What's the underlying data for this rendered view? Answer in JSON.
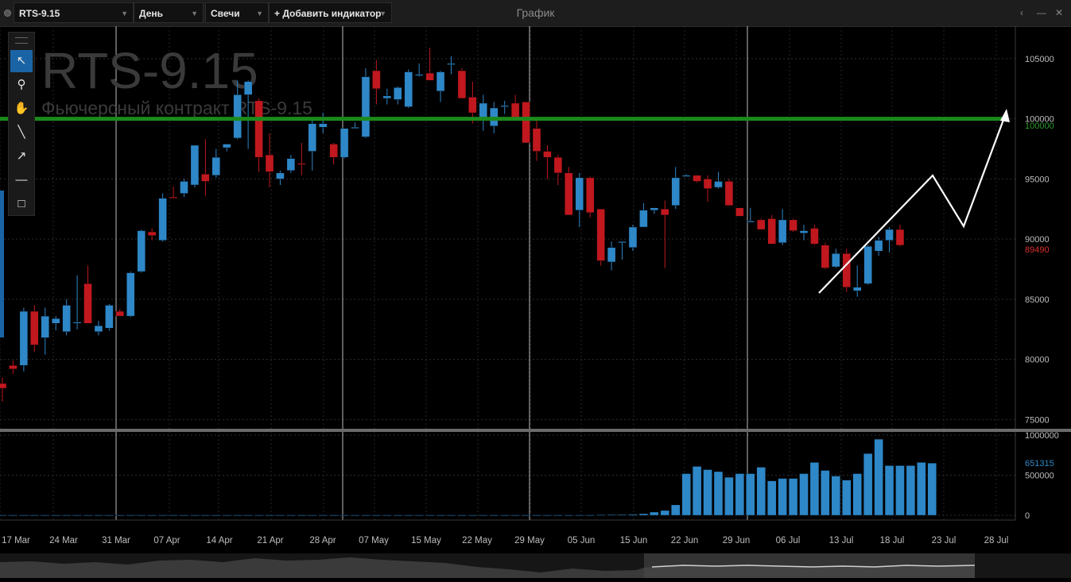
{
  "header": {
    "symbol": "RTS-9.15",
    "interval": "День",
    "chart_style": "Свечи",
    "add_indicator": "+ Добавить индикатор",
    "window_title": "График",
    "btn_back": "‹",
    "btn_min": "—",
    "btn_close": "✕"
  },
  "tools": [
    {
      "name": "pointer-icon",
      "glyph": "↖"
    },
    {
      "name": "zoom-icon",
      "glyph": "⚲"
    },
    {
      "name": "hand-icon",
      "glyph": "✋"
    },
    {
      "name": "line-icon",
      "glyph": "╲"
    },
    {
      "name": "arrow-icon",
      "glyph": "↗"
    },
    {
      "name": "horizontal-line-icon",
      "glyph": "—"
    },
    {
      "name": "rectangle-icon",
      "glyph": "□"
    }
  ],
  "colors": {
    "up": "#2e87c7",
    "down": "#c0181e",
    "level": "#1c8a1c",
    "volume": "#2e87c7",
    "price_label": "#d83030",
    "volume_label": "#2e87c7",
    "level_label": "#2a9a2a"
  },
  "chart_data": {
    "type": "candlestick",
    "watermark_title": "RTS-9.15",
    "watermark_subtitle": "Фьючерсный контракт RTS-9.15",
    "price_axis": {
      "ticks": [
        75000,
        80000,
        85000,
        90000,
        95000,
        100000,
        105000
      ],
      "range": [
        74300,
        107700
      ]
    },
    "volume_axis": {
      "ticks": [
        0,
        500000,
        1000000
      ],
      "labels": [
        "0",
        "500000",
        "1000000"
      ],
      "range": [
        0,
        1050000
      ]
    },
    "x_labels": [
      "17 Mar",
      "24 Mar",
      "31 Mar",
      "07 Apr",
      "14 Apr",
      "21 Apr",
      "28 Apr",
      "07 May",
      "15 May",
      "22 May",
      "29 May",
      "05 Jun",
      "15 Jun",
      "22 Jun",
      "29 Jun",
      "06 Jul",
      "13 Jul",
      "18 Jul",
      "23 Jul",
      "28 Jul"
    ],
    "last_price": "89490",
    "last_volume": "651315",
    "horizontal_level": {
      "value": 100000,
      "label": "100000"
    },
    "candles": [
      [
        78000,
        78500,
        76500,
        77600
      ],
      [
        79500,
        79900,
        78800,
        79200
      ],
      [
        79500,
        84300,
        79000,
        84000
      ],
      [
        84000,
        84500,
        80600,
        81200
      ],
      [
        81800,
        84300,
        80400,
        83600
      ],
      [
        83000,
        83600,
        82400,
        83400
      ],
      [
        82300,
        85000,
        82000,
        84500
      ],
      [
        83000,
        87000,
        82500,
        83100
      ],
      [
        86300,
        87800,
        83000,
        83000
      ],
      [
        82300,
        83200,
        82000,
        82800
      ],
      [
        82600,
        84600,
        82400,
        84500
      ],
      [
        84000,
        84200,
        83600,
        83600
      ],
      [
        83600,
        87300,
        83500,
        87200
      ],
      [
        87300,
        90800,
        87200,
        90700
      ],
      [
        90600,
        90900,
        89900,
        90300
      ],
      [
        89900,
        93800,
        89800,
        93400
      ],
      [
        93500,
        94400,
        93400,
        93400
      ],
      [
        93800,
        95000,
        93500,
        94800
      ],
      [
        94500,
        96900,
        94300,
        97800
      ],
      [
        95400,
        98300,
        93600,
        94800
      ],
      [
        95300,
        97500,
        95100,
        96800
      ],
      [
        97600,
        97900,
        97300,
        97900
      ],
      [
        98400,
        103200,
        98300,
        102000
      ],
      [
        102000,
        103200,
        97500,
        103100
      ],
      [
        101500,
        101700,
        95600,
        96800
      ],
      [
        97000,
        98800,
        94300,
        95600
      ],
      [
        95000,
        95700,
        94500,
        95500
      ],
      [
        95700,
        97000,
        95500,
        96700
      ],
      [
        96300,
        98000,
        95300,
        96200
      ],
      [
        97300,
        100000,
        95700,
        99600
      ],
      [
        99300,
        100500,
        98800,
        99600
      ],
      [
        97900,
        98000,
        96200,
        96800
      ],
      [
        96800,
        99200,
        96700,
        99200
      ],
      [
        99300,
        99700,
        99200,
        99300
      ],
      [
        98500,
        104200,
        98400,
        103500
      ],
      [
        104000,
        104900,
        101200,
        102500
      ],
      [
        101700,
        102500,
        101200,
        101900
      ],
      [
        101600,
        102700,
        101200,
        102600
      ],
      [
        101000,
        104100,
        100900,
        103900
      ],
      [
        103700,
        104600,
        103500,
        103700
      ],
      [
        103800,
        105900,
        103500,
        103200
      ],
      [
        102300,
        104000,
        101400,
        103900
      ],
      [
        104500,
        105200,
        103700,
        104600
      ],
      [
        104000,
        104200,
        101700,
        101700
      ],
      [
        101800,
        103100,
        99600,
        100500
      ],
      [
        100000,
        102000,
        99000,
        101300
      ],
      [
        99400,
        101400,
        98800,
        100900
      ],
      [
        101100,
        101500,
        100400,
        101100
      ],
      [
        101300,
        102000,
        100000,
        100000
      ],
      [
        101400,
        101400,
        98000,
        98000
      ],
      [
        99200,
        99900,
        96500,
        97300
      ],
      [
        97300,
        97800,
        95000,
        96800
      ],
      [
        96800,
        97000,
        94500,
        95500
      ],
      [
        95500,
        96000,
        92000,
        92000
      ],
      [
        92400,
        95500,
        91000,
        95100
      ],
      [
        95100,
        95200,
        91800,
        92200
      ],
      [
        92500,
        92500,
        87800,
        88200
      ],
      [
        88100,
        89800,
        87400,
        89300
      ],
      [
        89700,
        89800,
        88300,
        89800
      ],
      [
        89300,
        91200,
        89000,
        91000
      ],
      [
        91000,
        93000,
        91000,
        92400
      ],
      [
        92400,
        92600,
        92100,
        92600
      ],
      [
        92500,
        93200,
        87600,
        92000
      ],
      [
        92800,
        96000,
        92500,
        95100
      ],
      [
        95200,
        95400,
        95200,
        95300
      ],
      [
        95300,
        95300,
        94700,
        94800
      ],
      [
        95000,
        95300,
        93100,
        94200
      ],
      [
        94300,
        95600,
        94200,
        94800
      ],
      [
        94800,
        95000,
        92800,
        92800
      ],
      [
        92600,
        92500,
        92200,
        91900
      ],
      [
        91500,
        92600,
        91400,
        91500
      ],
      [
        91600,
        91700,
        90800,
        90800
      ],
      [
        91700,
        92000,
        89700,
        89600
      ],
      [
        89700,
        92500,
        89500,
        91600
      ],
      [
        91600,
        91700,
        90600,
        90700
      ],
      [
        90500,
        91200,
        89900,
        90700
      ],
      [
        90900,
        91200,
        89500,
        89600
      ],
      [
        89500,
        89700,
        87500,
        87600
      ],
      [
        87700,
        89200,
        87600,
        88800
      ],
      [
        88800,
        89200,
        85600,
        86000
      ],
      [
        85700,
        87800,
        85200,
        86000
      ],
      [
        86300,
        89500,
        86200,
        89400
      ],
      [
        89000,
        90200,
        88600,
        89900
      ],
      [
        89900,
        91000,
        88900,
        90800
      ],
      [
        90800,
        91200,
        89400,
        89490
      ]
    ],
    "volumes": [
      4000,
      4000,
      4000,
      4000,
      4000,
      4000,
      4000,
      4000,
      4000,
      4000,
      4000,
      4000,
      4000,
      4000,
      4000,
      4000,
      4000,
      4000,
      4000,
      4000,
      4000,
      4000,
      4000,
      4000,
      4000,
      4000,
      4000,
      4000,
      4000,
      4000,
      4000,
      4000,
      4000,
      4000,
      4000,
      4000,
      4000,
      4000,
      4000,
      4000,
      4000,
      4000,
      4000,
      4000,
      4000,
      4000,
      4000,
      4000,
      4000,
      4000,
      4000,
      4000,
      4000,
      4000,
      4000,
      4000,
      6000,
      8000,
      10000,
      12000,
      20000,
      40000,
      60000,
      130000,
      520000,
      610000,
      570000,
      545000,
      475000,
      520000,
      520000,
      600000,
      430000,
      460000,
      460000,
      520000,
      660000,
      560000,
      490000,
      440000,
      520000,
      770000,
      950000,
      620000,
      620000,
      620000,
      660000,
      651315
    ]
  }
}
